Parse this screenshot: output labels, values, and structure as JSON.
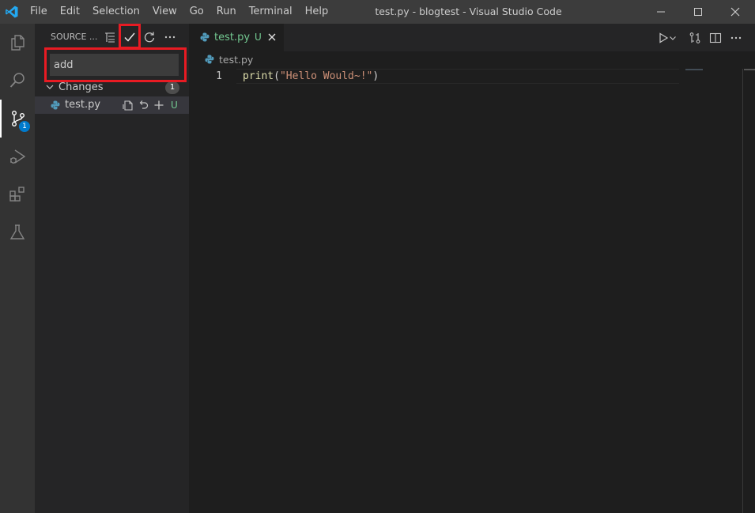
{
  "window": {
    "title": "test.py - blogtest - Visual Studio Code",
    "menu": [
      "File",
      "Edit",
      "Selection",
      "View",
      "Go",
      "Run",
      "Terminal",
      "Help"
    ]
  },
  "activity_bar": {
    "items": [
      "explorer-icon",
      "search-icon",
      "source-control-icon",
      "run-debug-icon",
      "extensions-icon",
      "testing-icon"
    ],
    "source_control_badge": "1"
  },
  "sidebar": {
    "title": "SOURCE ...",
    "commit_message": "add",
    "changes_label": "Changes",
    "changes_count": "1",
    "files": [
      {
        "name": "test.py",
        "status": "U"
      }
    ]
  },
  "editor": {
    "tab": {
      "label": "test.py",
      "status": "U"
    },
    "breadcrumb": "test.py",
    "lines": [
      {
        "number": "1",
        "fn": "print",
        "open": "(",
        "string": "\"Hello Would~!\"",
        "close": ")"
      }
    ]
  },
  "colors": {
    "accent": "#007acc",
    "highlight_box": "#e81b23",
    "untracked": "#73c991"
  }
}
